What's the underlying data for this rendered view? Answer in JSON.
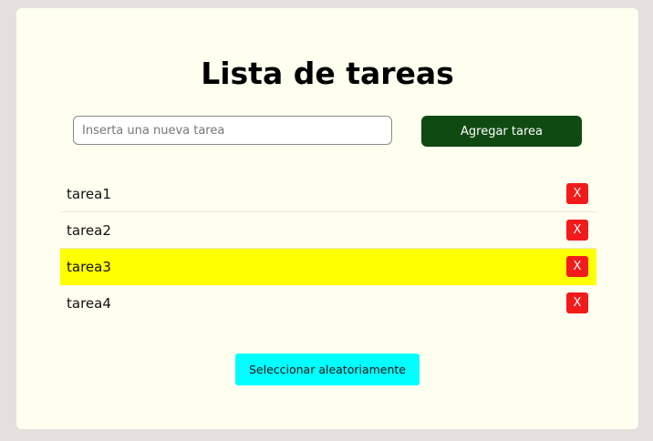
{
  "app": {
    "title": "Lista de tareas"
  },
  "new_task": {
    "placeholder": "Inserta una nueva tarea",
    "value": "",
    "add_label": "Agregar tarea"
  },
  "tasks": [
    {
      "label": "tarea1",
      "delete_label": "X",
      "highlighted": false
    },
    {
      "label": "tarea2",
      "delete_label": "X",
      "highlighted": false
    },
    {
      "label": "tarea3",
      "delete_label": "X",
      "highlighted": true
    },
    {
      "label": "tarea4",
      "delete_label": "X",
      "highlighted": false
    }
  ],
  "random_select": {
    "label": "Seleccionar aleatoriamente"
  },
  "colors": {
    "page_background": "#e5e0de",
    "card_background": "#fffff0",
    "add_button": "#0f4a13",
    "delete_button": "#f21b1b",
    "highlight": "#ffff00",
    "random_button": "#00ffff"
  }
}
